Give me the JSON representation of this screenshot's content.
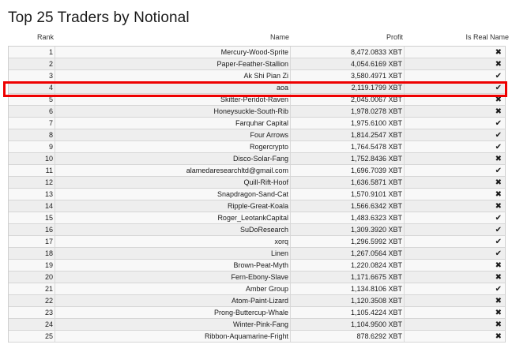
{
  "title": "Top 25 Traders by Notional",
  "headers": {
    "rank": "Rank",
    "name": "Name",
    "profit": "Profit",
    "real": "Is Real Name"
  },
  "colors": {
    "highlight": "#ee0000",
    "row_even": "#eeeeee",
    "row_odd": "#f8f8f8"
  },
  "rows": [
    {
      "rank": "1",
      "name": "Mercury-Wood-Sprite",
      "profit": "8,472.0833 XBT",
      "real": "✖"
    },
    {
      "rank": "2",
      "name": "Paper-Feather-Stallion",
      "profit": "4,054.6169 XBT",
      "real": "✖"
    },
    {
      "rank": "3",
      "name": "Ak Shi Pian Zi",
      "profit": "3,580.4971 XBT",
      "real": "✔"
    },
    {
      "rank": "4",
      "name": "aoa",
      "profit": "2,119.1799 XBT",
      "real": "✔"
    },
    {
      "rank": "5",
      "name": "Skitter-Peridot-Raven",
      "profit": "2,045.0067 XBT",
      "real": "✖"
    },
    {
      "rank": "6",
      "name": "Honeysuckle-South-Rib",
      "profit": "1,978.0278 XBT",
      "real": "✖"
    },
    {
      "rank": "7",
      "name": "Farquhar Capital",
      "profit": "1,975.6100 XBT",
      "real": "✔"
    },
    {
      "rank": "8",
      "name": "Four Arrows",
      "profit": "1,814.2547 XBT",
      "real": "✔"
    },
    {
      "rank": "9",
      "name": "Rogercrypto",
      "profit": "1,764.5478 XBT",
      "real": "✔"
    },
    {
      "rank": "10",
      "name": "Disco-Solar-Fang",
      "profit": "1,752.8436 XBT",
      "real": "✖"
    },
    {
      "rank": "11",
      "name": "alamedaresearchltd@gmail.com",
      "profit": "1,696.7039 XBT",
      "real": "✔"
    },
    {
      "rank": "12",
      "name": "Quill-Rift-Hoof",
      "profit": "1,636.5871 XBT",
      "real": "✖"
    },
    {
      "rank": "13",
      "name": "Snapdragon-Sand-Cat",
      "profit": "1,570.9101 XBT",
      "real": "✖"
    },
    {
      "rank": "14",
      "name": "Ripple-Great-Koala",
      "profit": "1,566.6342 XBT",
      "real": "✖"
    },
    {
      "rank": "15",
      "name": "Roger_LeotankCapital",
      "profit": "1,483.6323 XBT",
      "real": "✔"
    },
    {
      "rank": "16",
      "name": "SuDoResearch",
      "profit": "1,309.3920 XBT",
      "real": "✔"
    },
    {
      "rank": "17",
      "name": "xorq",
      "profit": "1,296.5992 XBT",
      "real": "✔"
    },
    {
      "rank": "18",
      "name": "Linen",
      "profit": "1,267.0564 XBT",
      "real": "✔"
    },
    {
      "rank": "19",
      "name": "Brown-Peat-Myth",
      "profit": "1,220.0824 XBT",
      "real": "✖"
    },
    {
      "rank": "20",
      "name": "Fern-Ebony-Slave",
      "profit": "1,171.6675 XBT",
      "real": "✖"
    },
    {
      "rank": "21",
      "name": "Amber Group",
      "profit": "1,134.8106 XBT",
      "real": "✔"
    },
    {
      "rank": "22",
      "name": "Atom-Paint-Lizard",
      "profit": "1,120.3508 XBT",
      "real": "✖"
    },
    {
      "rank": "23",
      "name": "Prong-Buttercup-Whale",
      "profit": "1,105.4224 XBT",
      "real": "✖"
    },
    {
      "rank": "24",
      "name": "Winter-Pink-Fang",
      "profit": "1,104.9500 XBT",
      "real": "✖"
    },
    {
      "rank": "25",
      "name": "Ribbon-Aquamarine-Fright",
      "profit": "878.6292 XBT",
      "real": "✖"
    }
  ]
}
